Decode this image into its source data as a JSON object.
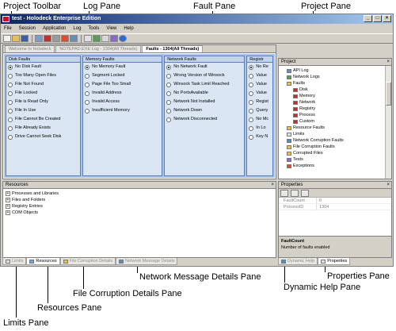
{
  "callouts": {
    "project_toolbar": "Project Toolbar",
    "log_pane": "Log Pane",
    "fault_pane": "Fault Pane",
    "project_pane": "Project Pane",
    "limits_pane": "Limits Pane",
    "resources_pane": "Resources Pane",
    "file_corruption_pane": "File Corruption Details Pane",
    "network_message_pane": "Network Message Details Pane",
    "dynamic_help_pane": "Dynamic Help Pane",
    "properties_pane": "Properties Pane"
  },
  "window": {
    "title": "test - Holodeck Enterprise Edition",
    "menu": [
      "File",
      "Session",
      "Application",
      "Log",
      "Tools",
      "View",
      "Help"
    ]
  },
  "toolbar_icons": [
    "new-icon",
    "open-icon",
    "save-icon",
    "app-icon",
    "stop-icon",
    "pause-icon",
    "fault-icon",
    "log-icon",
    "limits-icon",
    "network-icon",
    "report-icon",
    "settings-icon",
    "help-icon"
  ],
  "doc_tabs": [
    "Welcome to Holodeck",
    "NOTEPAD.EXE Log - 1304(All Threads)",
    "Faults - 1304(All Threads)"
  ],
  "fault_columns": [
    {
      "title": "Disk Faults",
      "items": [
        "No Disk Fault",
        "Too Many Open Files",
        "File Not Found",
        "File Locked",
        "File is Read Only",
        "File In Use",
        "File Cannot Be Created",
        "File Already Exists",
        "Drive Cannot Seek Disk"
      ],
      "selected": 0
    },
    {
      "title": "Memory Faults",
      "items": [
        "No Memory Fault",
        "Segment Locked",
        "Page File Too Small",
        "Invalid Address",
        "Invalid Access",
        "Insufficient Memory"
      ],
      "selected": 0
    },
    {
      "title": "Network Faults",
      "items": [
        "No Network Fault",
        "Wrong Version of Winsock",
        "Winsock Task Limit Reached",
        "No PortsAvailable",
        "Network Not Installed",
        "Network Down",
        "Network Disconnected"
      ],
      "selected": 0
    },
    {
      "title": "Registr",
      "items": [
        "No Re",
        "Value",
        "Value",
        "Value",
        "Regist",
        "Query",
        "No Mc",
        "In Lo",
        "Key N"
      ],
      "selected": 0
    }
  ],
  "project": {
    "title": "Project",
    "items": [
      {
        "label": "API Log",
        "indent": 1,
        "icon": "log-icon"
      },
      {
        "label": "Network Logs",
        "indent": 1,
        "icon": "network-log-icon"
      },
      {
        "label": "Faults",
        "indent": 1,
        "icon": "faults-folder-icon"
      },
      {
        "label": "Disk",
        "indent": 2,
        "icon": "disk-icon"
      },
      {
        "label": "Memory",
        "indent": 2,
        "icon": "memory-icon"
      },
      {
        "label": "Network",
        "indent": 2,
        "icon": "network-icon"
      },
      {
        "label": "Registry",
        "indent": 2,
        "icon": "registry-icon"
      },
      {
        "label": "Process",
        "indent": 2,
        "icon": "process-icon"
      },
      {
        "label": "Custom",
        "indent": 2,
        "icon": "custom-icon"
      },
      {
        "label": "Resource Faults",
        "indent": 1,
        "icon": "resource-faults-icon"
      },
      {
        "label": "Limits",
        "indent": 1,
        "icon": "limits-icon"
      },
      {
        "label": "Network Corruption Faults",
        "indent": 1,
        "icon": "net-corrupt-icon"
      },
      {
        "label": "File Corruption Faults",
        "indent": 1,
        "icon": "file-corrupt-icon"
      },
      {
        "label": "Corrupted Files",
        "indent": 1,
        "icon": "corrupted-files-icon"
      },
      {
        "label": "Tests",
        "indent": 1,
        "icon": "tests-icon"
      },
      {
        "label": "Exceptions",
        "indent": 1,
        "icon": "exceptions-icon"
      }
    ]
  },
  "resources": {
    "title": "Resources",
    "items": [
      "Processes and Libraries",
      "Files and Folders",
      "Registry Entries",
      "COM Objects"
    ]
  },
  "bottom_tabs": [
    "Limits",
    "Resources",
    "File Corruption Details",
    "Network Message Details"
  ],
  "properties": {
    "title": "Properties",
    "rows": [
      {
        "key": "FaultCount",
        "value": "0"
      },
      {
        "key": "ProcessID",
        "value": "1304"
      }
    ],
    "desc_title": "FaultCount",
    "desc_text": "Number of faults enabled"
  },
  "right_tabs": [
    "Dynamic Help",
    "Properties"
  ]
}
